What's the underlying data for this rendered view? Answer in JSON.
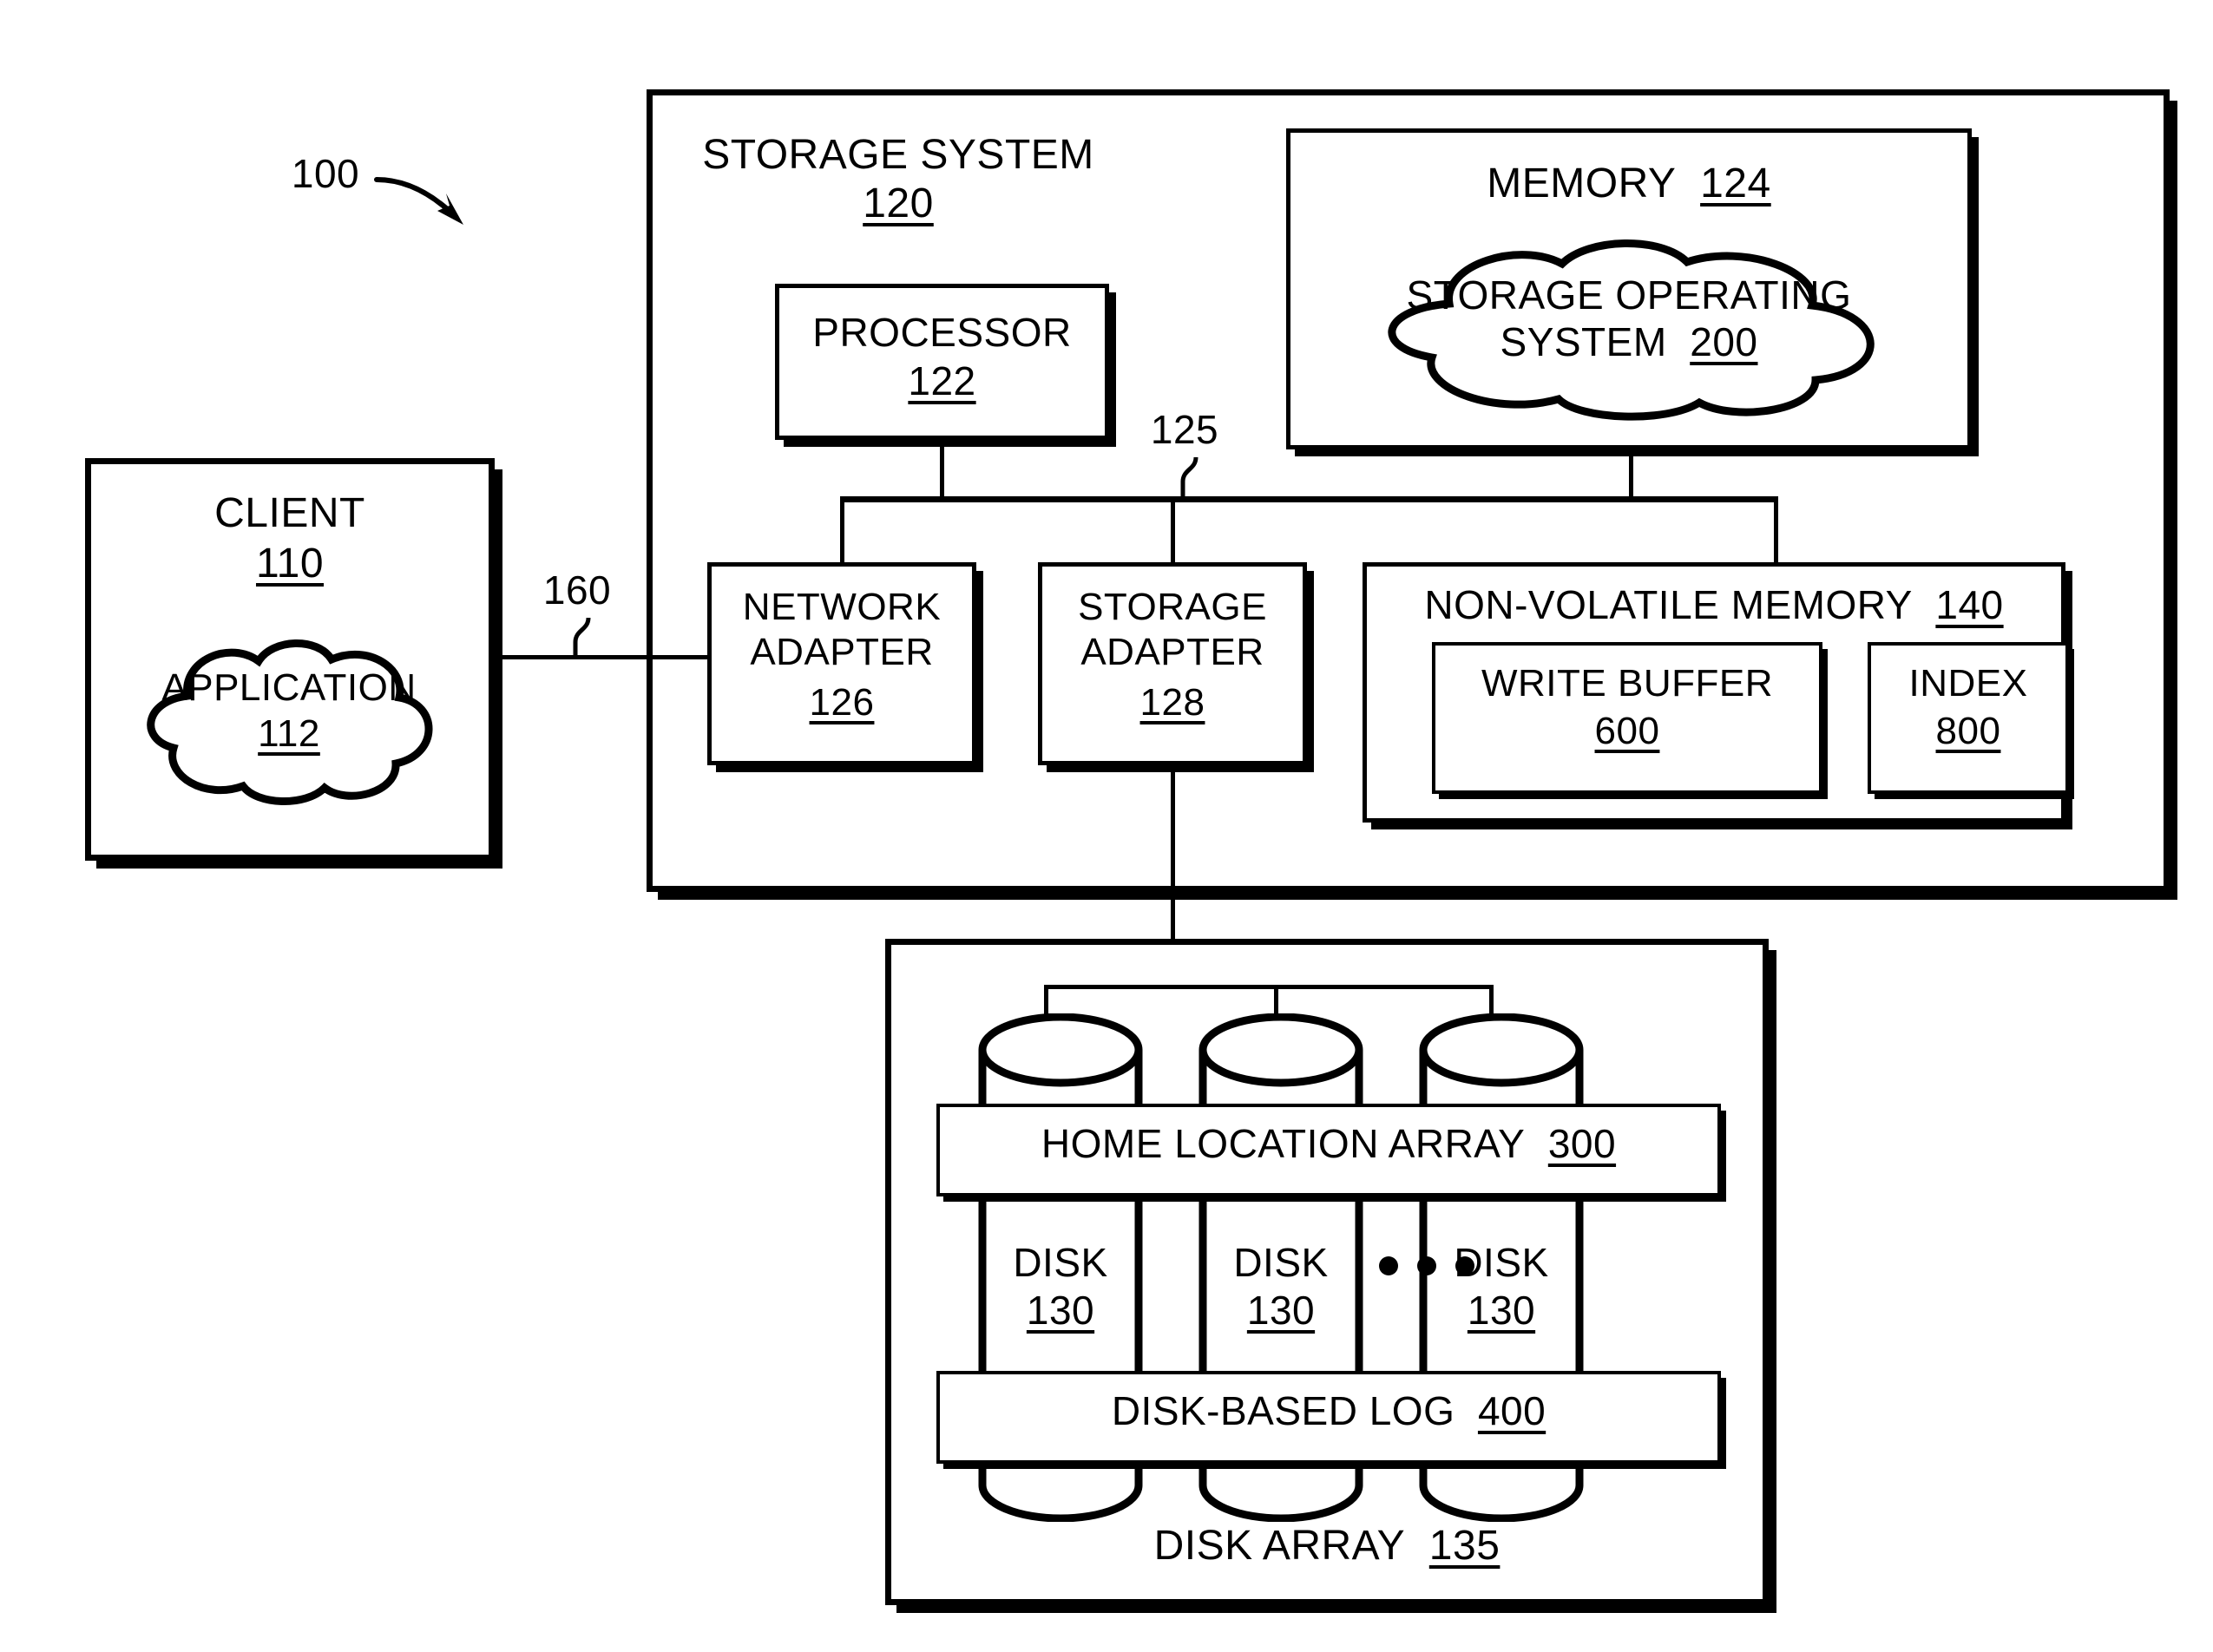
{
  "figure": {
    "ref_label": "100",
    "arrow_icon": "curved-arrow-icon"
  },
  "client": {
    "title": "CLIENT",
    "ref": "110",
    "application": {
      "title": "APPLICATION",
      "ref": "112",
      "shape": "cloud"
    }
  },
  "network_link": {
    "ref": "160"
  },
  "storage_system": {
    "title": "STORAGE SYSTEM",
    "ref": "120",
    "bus_ref": "125",
    "processor": {
      "title": "PROCESSOR",
      "ref": "122"
    },
    "memory": {
      "title": "MEMORY",
      "ref": "124",
      "operating_system": {
        "line1": "STORAGE OPERATING",
        "line2": "SYSTEM",
        "ref": "200",
        "shape": "cloud"
      }
    },
    "network_adapter": {
      "line1": "NETWORK",
      "line2": "ADAPTER",
      "ref": "126"
    },
    "storage_adapter": {
      "line1": "STORAGE",
      "line2": "ADAPTER",
      "ref": "128"
    },
    "non_volatile_memory": {
      "title": "NON-VOLATILE MEMORY",
      "ref": "140",
      "write_buffer": {
        "title": "WRITE BUFFER",
        "ref": "600"
      },
      "index": {
        "title": "INDEX",
        "ref": "800"
      }
    }
  },
  "disk_array": {
    "title": "DISK ARRAY",
    "ref": "135",
    "home_location_array": {
      "title": "HOME LOCATION ARRAY",
      "ref": "300"
    },
    "disk_based_log": {
      "title": "DISK-BASED LOG",
      "ref": "400"
    },
    "disks": [
      {
        "title": "DISK",
        "ref": "130"
      },
      {
        "title": "DISK",
        "ref": "130"
      },
      {
        "title": "DISK",
        "ref": "130"
      }
    ],
    "ellipsis_icon": "three-dots-icon"
  },
  "colors": {
    "ink": "#000000",
    "paper": "#ffffff"
  }
}
